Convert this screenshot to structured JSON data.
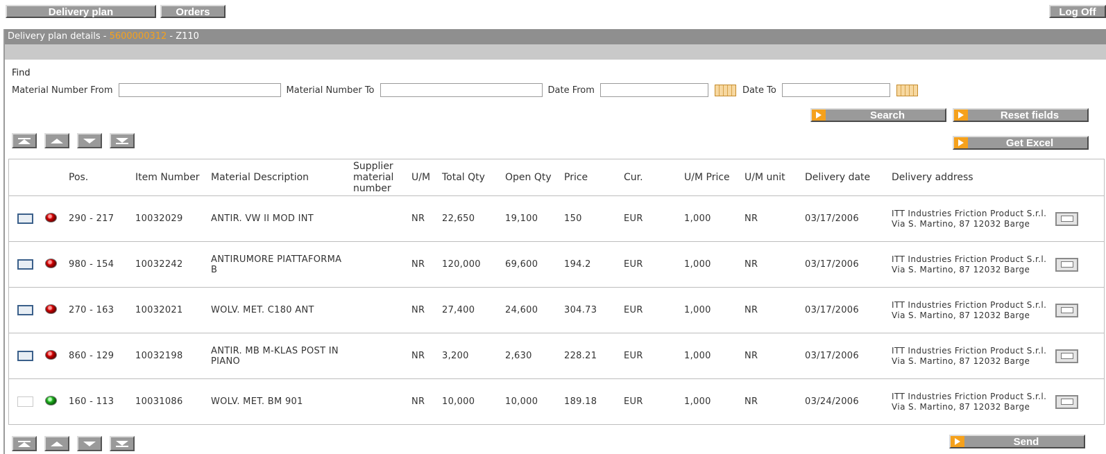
{
  "nav": {
    "delivery_plan": "Delivery plan",
    "orders": "Orders",
    "log_off": "Log Off"
  },
  "panel": {
    "title_prefix": "Delivery plan details - ",
    "plan_number": "5600000312",
    "title_suffix": " - Z110"
  },
  "find": {
    "label": "Find",
    "material_from_label": "Material Number From",
    "material_from_value": "",
    "material_to_label": "Material Number To",
    "material_to_value": "",
    "date_from_label": "Date From",
    "date_from_value": "",
    "date_to_label": "Date To",
    "date_to_value": ""
  },
  "actions": {
    "search": "Search",
    "reset": "Reset fields",
    "excel": "Get Excel",
    "send": "Send"
  },
  "columns": {
    "pos": "Pos.",
    "item_number": "Item Number",
    "material_description": "Material Description",
    "supplier_material_number": "Supplier material number",
    "um": "U/M",
    "total_qty": "Total Qty",
    "open_qty": "Open Qty",
    "price": "Price",
    "cur": "Cur.",
    "um_price": "U/M Price",
    "um_unit": "U/M unit",
    "delivery_date": "Delivery date",
    "delivery_address": "Delivery address"
  },
  "rows": [
    {
      "status": "red",
      "pos": "290 - 217",
      "item": "10032029",
      "desc": "ANTIR. VW II MOD INT",
      "supplier": "",
      "um": "NR",
      "total": "22,650",
      "open": "19,100",
      "price": "150",
      "cur": "EUR",
      "um_price": "1,000",
      "um_unit": "NR",
      "date": "03/17/2006",
      "address": "ITT Industries Friction Product S.r.l. Via S. Martino, 87 12032 Barge"
    },
    {
      "status": "red",
      "pos": "980 - 154",
      "item": "10032242",
      "desc": "ANTIRUMORE PIATTAFORMA B",
      "supplier": "",
      "um": "NR",
      "total": "120,000",
      "open": "69,600",
      "price": "194.2",
      "cur": "EUR",
      "um_price": "1,000",
      "um_unit": "NR",
      "date": "03/17/2006",
      "address": "ITT Industries Friction Product S.r.l. Via S. Martino, 87 12032 Barge"
    },
    {
      "status": "red",
      "pos": "270 - 163",
      "item": "10032021",
      "desc": "WOLV. MET. C180 ANT",
      "supplier": "",
      "um": "NR",
      "total": "27,400",
      "open": "24,600",
      "price": "304.73",
      "cur": "EUR",
      "um_price": "1,000",
      "um_unit": "NR",
      "date": "03/17/2006",
      "address": "ITT Industries Friction Product S.r.l. Via S. Martino, 87 12032 Barge"
    },
    {
      "status": "red",
      "pos": "860 - 129",
      "item": "10032198",
      "desc": "ANTIR. MB M-KLAS POST IN PIANO",
      "supplier": "",
      "um": "NR",
      "total": "3,200",
      "open": "2,630",
      "price": "228.21",
      "cur": "EUR",
      "um_price": "1,000",
      "um_unit": "NR",
      "date": "03/17/2006",
      "address": "ITT Industries Friction Product S.r.l. Via S. Martino, 87 12032 Barge"
    },
    {
      "status": "green",
      "pos": "160 - 113",
      "item": "10031086",
      "desc": "WOLV. MET. BM 901",
      "supplier": "",
      "um": "NR",
      "total": "10,000",
      "open": "10,000",
      "price": "189.18",
      "cur": "EUR",
      "um_price": "1,000",
      "um_unit": "NR",
      "date": "03/24/2006",
      "address": "ITT Industries Friction Product S.r.l. Via S. Martino, 87 12032 Barge"
    }
  ],
  "colors": {
    "accent": "#f5a11c",
    "bar": "#8f8f8f",
    "status_red": "#d00000",
    "status_green": "#20b020"
  },
  "icons": {
    "pager": [
      "first-page-icon",
      "prev-page-icon",
      "next-page-icon",
      "last-page-icon"
    ],
    "calendar": "calendar-icon",
    "row_detail": "address-detail-icon"
  }
}
